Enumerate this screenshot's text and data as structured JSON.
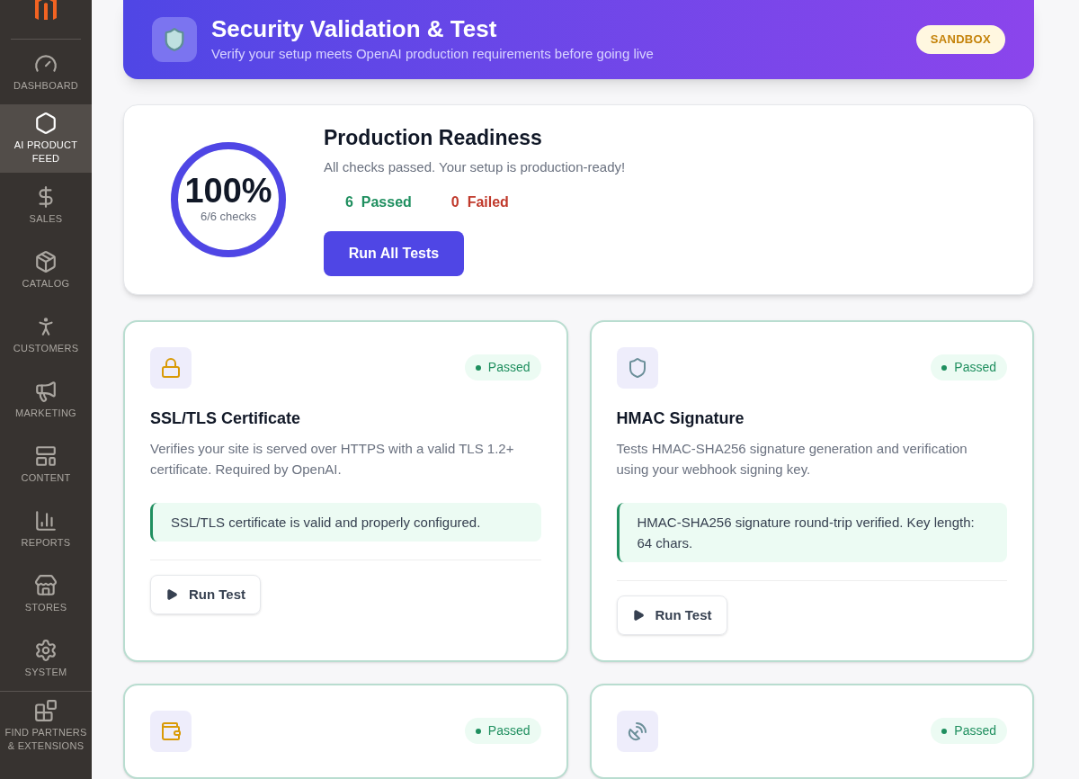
{
  "sidebar": {
    "items": [
      {
        "label": "DASHBOARD",
        "selected": false
      },
      {
        "label": "AI PRODUCT FEED",
        "selected": true
      },
      {
        "label": "SALES",
        "selected": false
      },
      {
        "label": "CATALOG",
        "selected": false
      },
      {
        "label": "CUSTOMERS",
        "selected": false
      },
      {
        "label": "MARKETING",
        "selected": false
      },
      {
        "label": "CONTENT",
        "selected": false
      },
      {
        "label": "REPORTS",
        "selected": false
      },
      {
        "label": "STORES",
        "selected": false
      },
      {
        "label": "SYSTEM",
        "selected": false
      },
      {
        "label": "FIND PARTNERS & EXTENSIONS",
        "selected": false
      }
    ]
  },
  "header": {
    "title": "Security Validation & Test",
    "subtitle": "Verify your setup meets OpenAI production requirements before going live",
    "badge": "SANDBOX"
  },
  "readiness": {
    "percent": "100%",
    "checks": "6/6 checks",
    "level": 1,
    "title": "Production Readiness",
    "message": "All checks passed. Your setup is production-ready!",
    "passed_count": "6",
    "passed_label": "Passed",
    "failed_count": "0",
    "failed_label": "Failed",
    "button": "Run All Tests"
  },
  "tests": [
    {
      "passed": true,
      "badge": "Passed",
      "title": "SSL/TLS Certificate",
      "description": "Verifies your site is served over HTTPS with a valid TLS 1.2+ certificate. Required by OpenAI.",
      "result": "SSL/TLS certificate is valid and properly configured.",
      "button": "Run Test"
    },
    {
      "passed": true,
      "badge": "Passed",
      "title": "HMAC Signature",
      "description": "Tests HMAC-SHA256 signature generation and verification using your webhook signing key.",
      "result": "HMAC-SHA256 signature round-trip verified. Key length: 64 chars.",
      "button": "Run Test"
    },
    {
      "passed": true,
      "badge": "Passed"
    },
    {
      "passed": true,
      "badge": "Passed"
    }
  ]
}
